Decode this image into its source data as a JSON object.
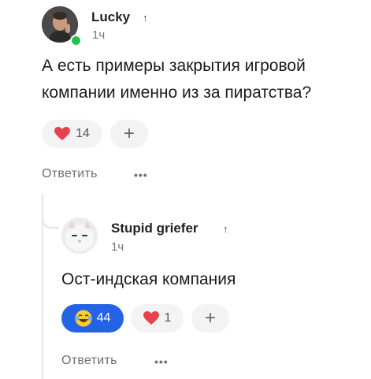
{
  "comment": {
    "author": "Lucky",
    "up_arrow": "↑",
    "time": "1ч",
    "text_line1": "А есть примеры закрытия игровой",
    "text_line2": "компании именно из за пиратства?",
    "heart_count": "14",
    "add_reaction": "+",
    "reply_label": "Ответить",
    "more": "•••",
    "online_color": "#27c24c"
  },
  "reply": {
    "author": "Stupid griefer",
    "up_arrow": "↑",
    "time": "1ч",
    "text": "Ост-индская компания",
    "laugh_count": "44",
    "heart_count": "1",
    "add_reaction": "+",
    "reply_label": "Ответить",
    "more": "•••",
    "active_reaction_color": "#2563e6"
  },
  "icons": [
    "heart-icon",
    "laughing-emoji-icon",
    "plus-icon",
    "more-dots-icon",
    "online-indicator"
  ]
}
